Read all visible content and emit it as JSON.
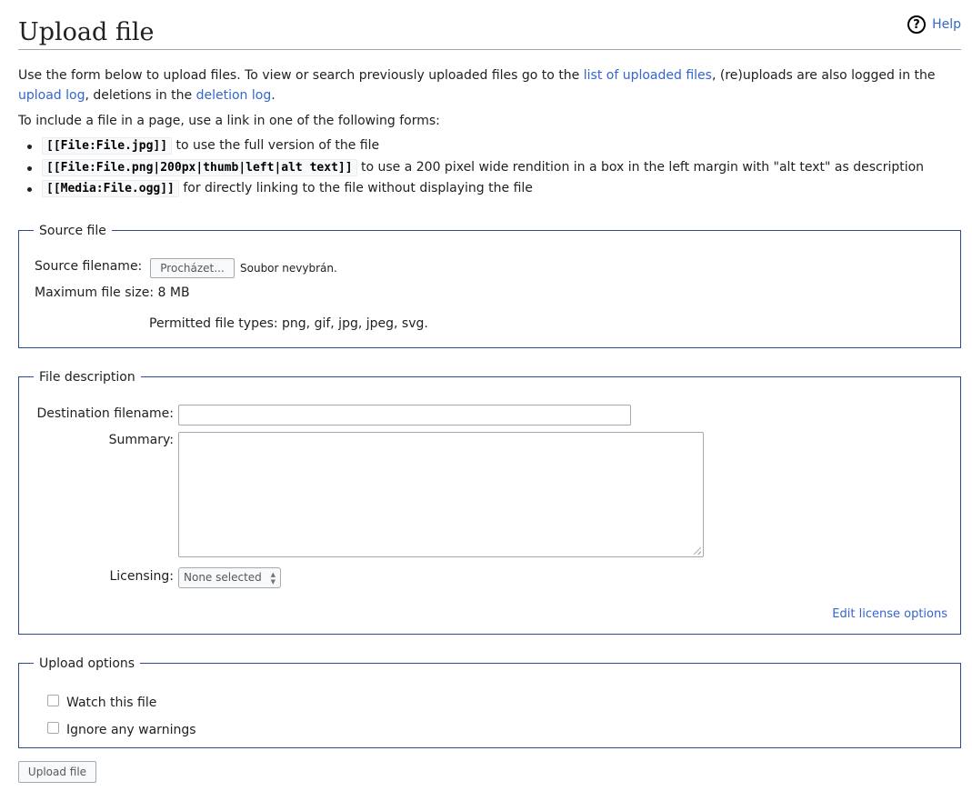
{
  "page": {
    "title": "Upload file",
    "help_label": "Help",
    "help_icon": "?"
  },
  "intro": {
    "part1": "Use the form below to upload files. To view or search previously uploaded files go to the ",
    "link_uploaded": "list of uploaded files",
    "part2": ", (re)uploads are also logged in the ",
    "link_upload_log": "upload log",
    "part3": ", deletions in the ",
    "link_deletion_log": "deletion log",
    "part4": "."
  },
  "include_text": "To include a file in a page, use a link in one of the following forms:",
  "forms": [
    {
      "code": "[[File:File.jpg]]",
      "desc": " to use the full version of the file"
    },
    {
      "code": "[[File:File.png|200px|thumb|left|alt text]]",
      "desc": " to use a 200 pixel wide rendition in a box in the left margin with \"alt text\" as description"
    },
    {
      "code": "[[Media:File.ogg]]",
      "desc": " for directly linking to the file without displaying the file"
    }
  ],
  "source_file": {
    "legend": "Source file",
    "filename_label": "Source filename:",
    "browse_button": "Procházet...",
    "no_file": "Soubor nevybrán.",
    "max_size": "Maximum file size: 8 MB",
    "permitted_types": "Permitted file types: png, gif, jpg, jpeg, svg."
  },
  "file_description": {
    "legend": "File description",
    "destination_label": "Destination filename:",
    "destination_value": "",
    "summary_label": "Summary:",
    "summary_value": "",
    "licensing_label": "Licensing:",
    "licensing_selected": "None selected",
    "edit_license_link": "Edit license options"
  },
  "upload_options": {
    "legend": "Upload options",
    "watch_label": "Watch this file",
    "watch_checked": false,
    "ignore_label": "Ignore any warnings",
    "ignore_checked": false
  },
  "submit_button": "Upload file",
  "colors": {
    "link": "#3366cc",
    "fieldset_border": "#2a4b8d",
    "text": "#202122"
  }
}
